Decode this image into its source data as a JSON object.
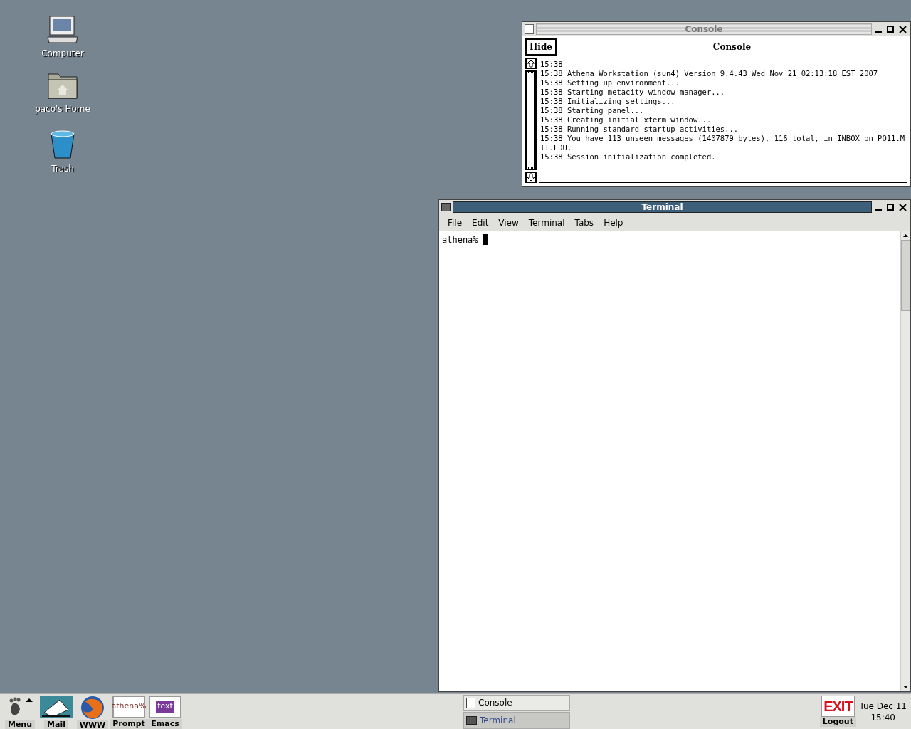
{
  "desktop_icons": [
    {
      "kind": "computer",
      "label": "Computer"
    },
    {
      "kind": "home",
      "label": "paco's Home"
    },
    {
      "kind": "trash",
      "label": "Trash"
    }
  ],
  "console_window": {
    "title": "Console",
    "focused": false,
    "hide_button": "Hide",
    "heading": "Console",
    "lines": [
      "15:38",
      "15:38 Athena Workstation (sun4) Version 9.4.43 Wed Nov 21 02:13:18 EST 2007",
      "15:38 Setting up environment...",
      "15:38 Starting metacity window manager...",
      "15:38 Initializing settings...",
      "15:38 Starting panel...",
      "15:38 Creating initial xterm window...",
      "15:38 Running standard startup activities...",
      "15:38 You have 113 unseen messages (1407879 bytes), 116 total, in INBOX on PO11.MIT.EDU.",
      "15:38 Session initialization completed."
    ]
  },
  "terminal_window": {
    "title": "Terminal",
    "focused": true,
    "menu": [
      "File",
      "Edit",
      "View",
      "Terminal",
      "Tabs",
      "Help"
    ],
    "prompt": "athena%"
  },
  "panel": {
    "launchers": [
      {
        "kind": "menu",
        "label": "Menu"
      },
      {
        "kind": "mail",
        "label": "Mail"
      },
      {
        "kind": "www",
        "label": "WWW"
      },
      {
        "kind": "prompt",
        "label": "Prompt",
        "icon_text": "athena%"
      },
      {
        "kind": "emacs",
        "label": "Emacs",
        "icon_text": "text"
      }
    ],
    "tasks": [
      {
        "kind": "console",
        "label": "Console",
        "selected": false
      },
      {
        "kind": "terminal",
        "label": "Terminal",
        "selected": true
      }
    ],
    "logout": {
      "sign": "EXIT",
      "label": "Logout"
    },
    "clock": {
      "date": "Tue Dec 11",
      "time": "15:40"
    }
  }
}
